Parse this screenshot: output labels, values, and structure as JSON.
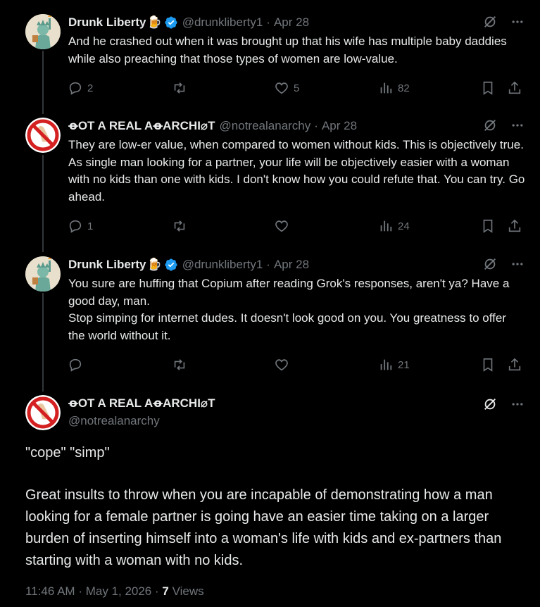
{
  "replies": [
    {
      "name": "Drunk Liberty",
      "name_emoji": "🍺",
      "verified": true,
      "handle": "@drunkliberty1",
      "date": "Apr 28",
      "text": [
        "And he crashed out when it was brought up that his wife has multiple baby daddies while also preaching that those types of women are low-value."
      ],
      "replies": "2",
      "retweets": "",
      "likes": "5",
      "views": "82"
    },
    {
      "name": "ꝋOT A REAL AꝋARCHI⌀T",
      "name_emoji": "",
      "verified": false,
      "handle": "@notrealanarchy",
      "date": "Apr 28",
      "text": [
        "They are low-er value, when compared to women without kids. This is objectively true. As single man looking for a partner, your life will be objectively easier with a woman with no kids than one with kids. I don't know how you could refute that. You can try. Go ahead."
      ],
      "replies": "1",
      "retweets": "",
      "likes": "",
      "views": "24"
    },
    {
      "name": "Drunk Liberty",
      "name_emoji": "🍺",
      "verified": true,
      "handle": "@drunkliberty1",
      "date": "Apr 28",
      "text": [
        "You sure are huffing that Copium after reading Grok's responses, aren't ya? Have a good day,  man.",
        "Stop simping for internet dudes. It doesn't look good on you. You greatness to offer the world without it."
      ],
      "replies": "",
      "retweets": "",
      "likes": "",
      "views": "21"
    }
  ],
  "main": {
    "name": "ꝋOT A REAL AꝋARCHI⌀T",
    "handle": "@notrealanarchy",
    "paragraph1": "\"cope\" \"simp\"",
    "paragraph2": "Great insults to throw when you are incapable of demonstrating how a man looking for a female partner is going have an easier time taking on a larger burden of inserting himself into a woman's life with kids and ex-partners than starting with a woman with no kids.",
    "time": "11:46 AM",
    "date": "May 1, 2026",
    "views_count": "7",
    "views_label": "Views"
  },
  "colors": {
    "background": "#000000",
    "text": "#e7e9ea",
    "muted": "#71767b",
    "verified": "#1d9bf0",
    "divider": "#333639"
  },
  "icons": [
    "reply-icon",
    "retweet-icon",
    "like-icon",
    "views-icon",
    "bookmark-icon",
    "share-icon",
    "grok-icon",
    "more-icon",
    "verified-badge-icon"
  ]
}
